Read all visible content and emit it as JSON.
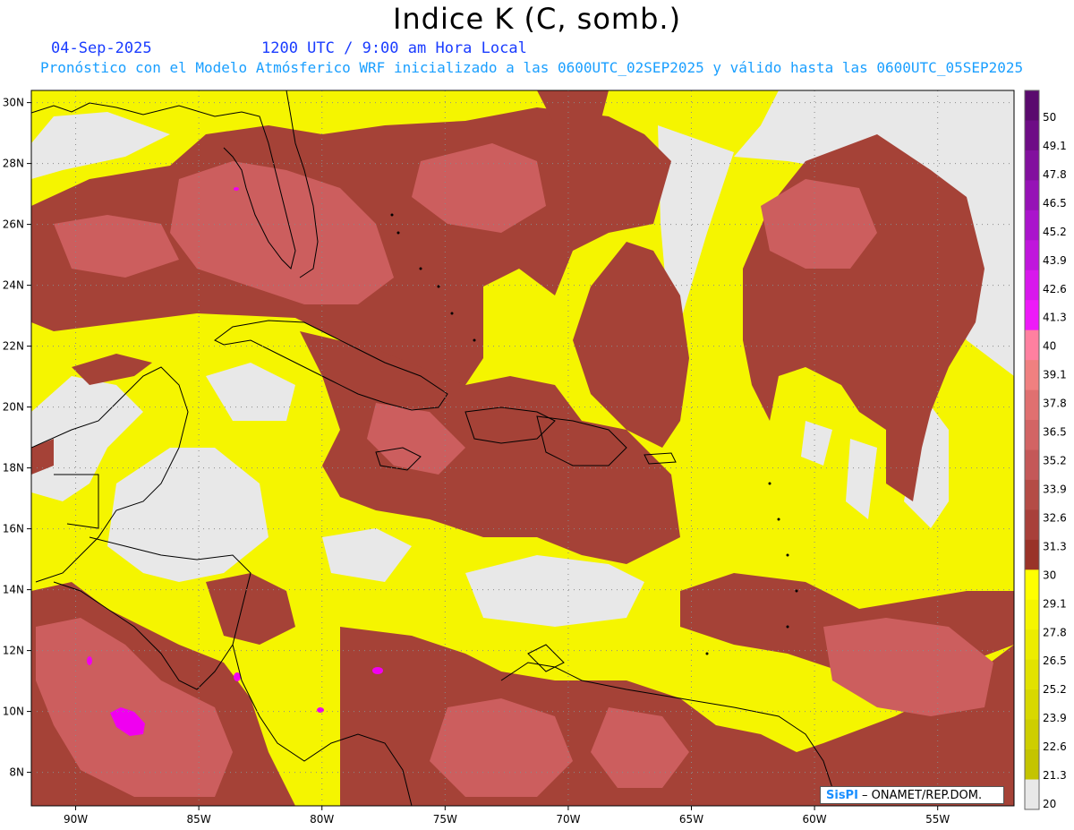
{
  "title": "Indice K (C, somb.)",
  "date_text": "04-Sep-2025",
  "time_text": "1200 UTC / 9:00 am Hora Local",
  "forecast_text": "Pronóstico con el Modelo Atmósferico WRF inicializado a las 0600UTC_02SEP2025 y válido hasta las  0600UTC_05SEP2025",
  "credit": {
    "brand": "SisPI",
    "org": " – ONAMET/REP.DOM."
  },
  "map": {
    "lon_labels": [
      "90W",
      "85W",
      "80W",
      "75W",
      "70W",
      "65W",
      "60W",
      "55W"
    ],
    "lon_values": [
      -90,
      -85,
      -80,
      -75,
      -70,
      -65,
      -60,
      -55
    ],
    "lat_labels": [
      "30N",
      "28N",
      "26N",
      "24N",
      "22N",
      "20N",
      "18N",
      "16N",
      "14N",
      "12N",
      "10N",
      "8N"
    ],
    "lat_values": [
      30,
      28,
      26,
      24,
      22,
      20,
      18,
      16,
      14,
      12,
      10,
      8
    ],
    "extent": {
      "lon_min": -91.8,
      "lon_max": -51.9,
      "lat_min": 6.9,
      "lat_max": 30.4
    },
    "grid": "dotted"
  },
  "colorbar": {
    "labels": [
      "50",
      "49.1",
      "47.8",
      "46.5",
      "45.2",
      "43.9",
      "42.6",
      "41.3",
      "40",
      "39.1",
      "37.8",
      "36.5",
      "35.2",
      "33.9",
      "32.6",
      "31.3",
      "30",
      "29.1",
      "27.8",
      "26.5",
      "25.2",
      "23.9",
      "22.6",
      "21.3",
      "20"
    ],
    "colors": [
      "#5a0a6e",
      "#6e0c86",
      "#82109e",
      "#9612b6",
      "#aa14cc",
      "#c016dc",
      "#d818ec",
      "#ee1af8",
      "#ff80a0",
      "#f08080",
      "#e07070",
      "#d26464",
      "#c45858",
      "#b44c46",
      "#a8403a",
      "#993328",
      "#ffff00",
      "#f5f500",
      "#ecec00",
      "#e2e200",
      "#d8d800",
      "#cece00",
      "#c4c400",
      "#e8e8e8"
    ]
  },
  "legend_colors": {
    "land_gray": "#e8e8e8",
    "yellow": "#f5f500",
    "brown": "#a54237",
    "red": "#cc5e5e",
    "salmon": "#e37474",
    "magenta": "#f000f0"
  }
}
